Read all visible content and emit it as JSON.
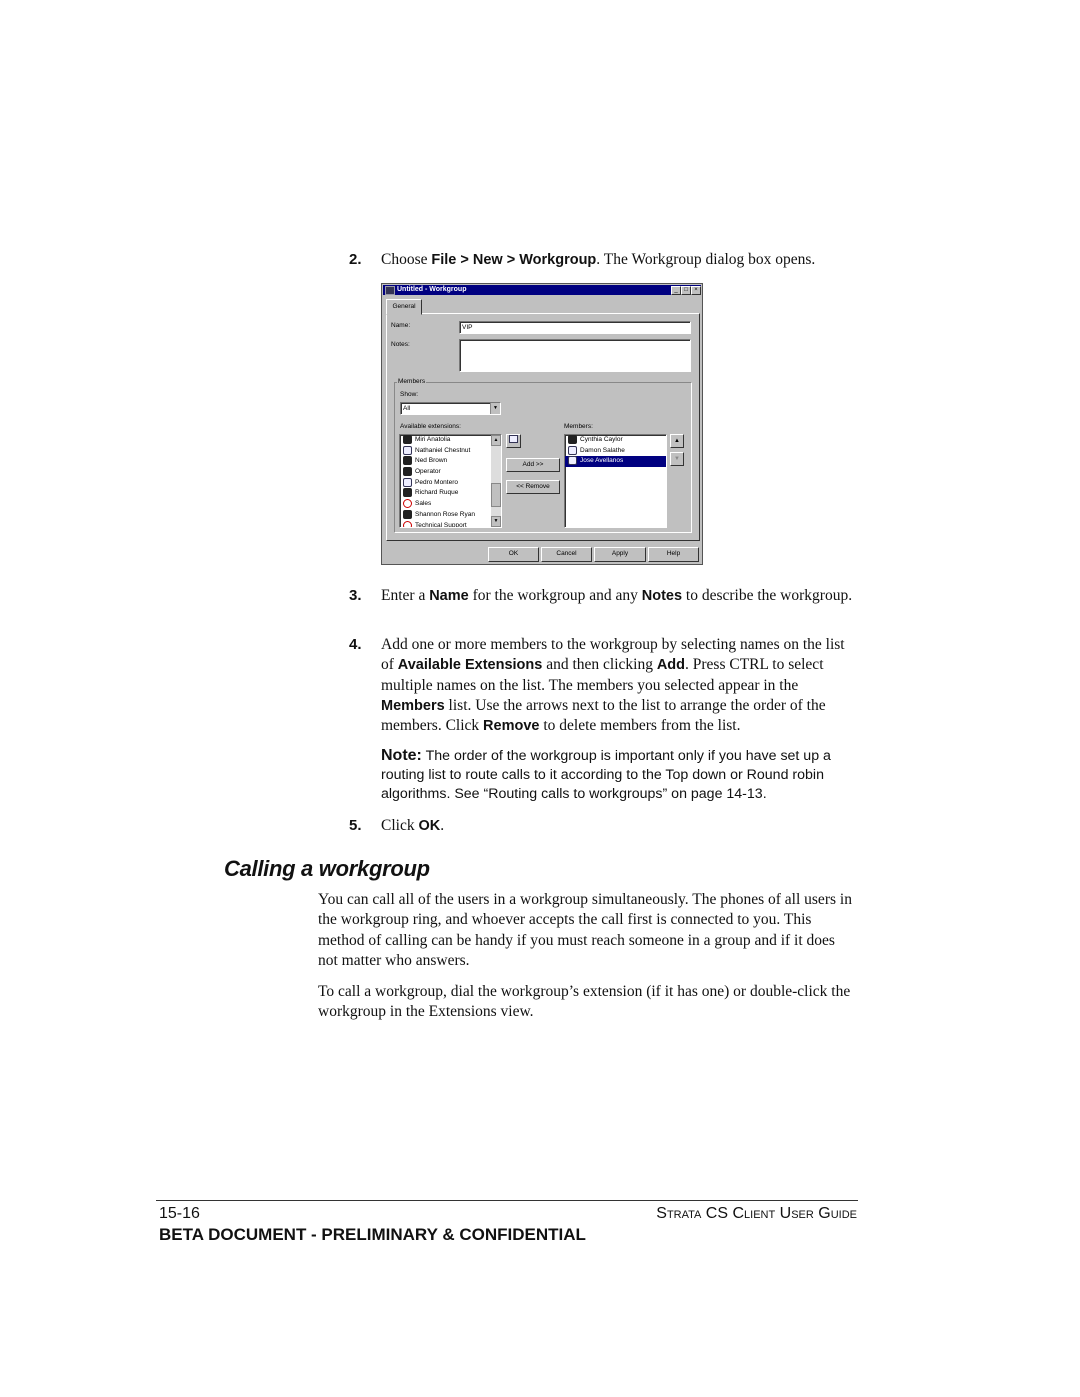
{
  "steps": [
    {
      "num": "2.",
      "parts": [
        {
          "t": "Choose "
        },
        {
          "t": "File > New > Workgroup",
          "b": true
        },
        {
          "t": ". The Workgroup dialog box opens."
        }
      ]
    },
    {
      "num": "3.",
      "parts": [
        {
          "t": "Enter a "
        },
        {
          "t": "Name",
          "b": true
        },
        {
          "t": " for the workgroup and any "
        },
        {
          "t": "Notes",
          "b": true
        },
        {
          "t": " to describe the workgroup."
        }
      ]
    },
    {
      "num": "4.",
      "parts": [
        {
          "t": "Add one or more members to the workgroup by selecting names on the list of "
        },
        {
          "t": "Available Extensions",
          "b": true
        },
        {
          "t": " and then clicking "
        },
        {
          "t": "Add",
          "b": true
        },
        {
          "t": ". Press CTRL to select multiple names on the list. The members you selected appear in the "
        },
        {
          "t": "Members",
          "b": true
        },
        {
          "t": " list. Use the arrows next to the list to arrange the order of the members. Click "
        },
        {
          "t": "Remove",
          "b": true
        },
        {
          "t": " to delete members from the list."
        }
      ]
    },
    {
      "num": "5.",
      "parts": [
        {
          "t": "Click "
        },
        {
          "t": "OK",
          "b": true
        },
        {
          "t": "."
        }
      ]
    }
  ],
  "note": {
    "label": "Note:",
    "text": " The order of the workgroup is important only if you have set up a routing list to route calls to it according to the Top down or Round robin algorithms. See “Routing calls to workgroups” on page 14-13."
  },
  "section": {
    "heading": "Calling a workgroup",
    "paragraphs": [
      "You can call all of the users in a workgroup simultaneously. The phones of all users in the workgroup ring, and whoever accepts the call first is connected to you. This method of calling can be handy if you must reach someone in a group and if it does not matter who answers.",
      "To call a workgroup, dial the workgroup’s extension (if it has one) or double-click the workgroup in the Extensions view."
    ]
  },
  "footer": {
    "page": "15-16",
    "guide": "Strata CS Client User Guide",
    "confidential": "BETA DOCUMENT - PRELIMINARY & CONFIDENTIAL"
  },
  "dialog": {
    "title": "Untitled - Workgroup",
    "tab": "General",
    "name_label": "Name:",
    "name_value": "VIP",
    "notes_label": "Notes:",
    "notes_value": "",
    "members_group": "Members",
    "show_label": "Show:",
    "show_value": "All",
    "available_label": "Available extensions:",
    "available": [
      {
        "name": "Miri Anatolia",
        "icon": "person-icon"
      },
      {
        "name": "Nathaniel Chestnut",
        "icon": "phone-icon"
      },
      {
        "name": "Ned Brown",
        "icon": "person-icon"
      },
      {
        "name": "Operator",
        "icon": "person-icon"
      },
      {
        "name": "Pedro Montero",
        "icon": "phone-icon"
      },
      {
        "name": "Richard Ruque",
        "icon": "person-icon"
      },
      {
        "name": "Sales",
        "icon": "workgroup-icon"
      },
      {
        "name": "Shannon Rose Ryan",
        "icon": "person-icon"
      },
      {
        "name": "Technical Support",
        "icon": "workgroup-icon"
      }
    ],
    "members_label": "Members:",
    "members": [
      {
        "name": "Cynthia Caylor",
        "icon": "person-icon",
        "selected": false
      },
      {
        "name": "Damon Salathe",
        "icon": "phone-icon",
        "selected": false
      },
      {
        "name": "Jose Avellanos",
        "icon": "phone-icon",
        "selected": true
      }
    ],
    "add_label": "Add >>",
    "remove_label": "<< Remove",
    "ok": "OK",
    "cancel": "Cancel",
    "apply": "Apply",
    "help": "Help",
    "colors": {
      "titlebar": "#000080",
      "face": "#c0c0c0",
      "selection": "#000080"
    }
  }
}
